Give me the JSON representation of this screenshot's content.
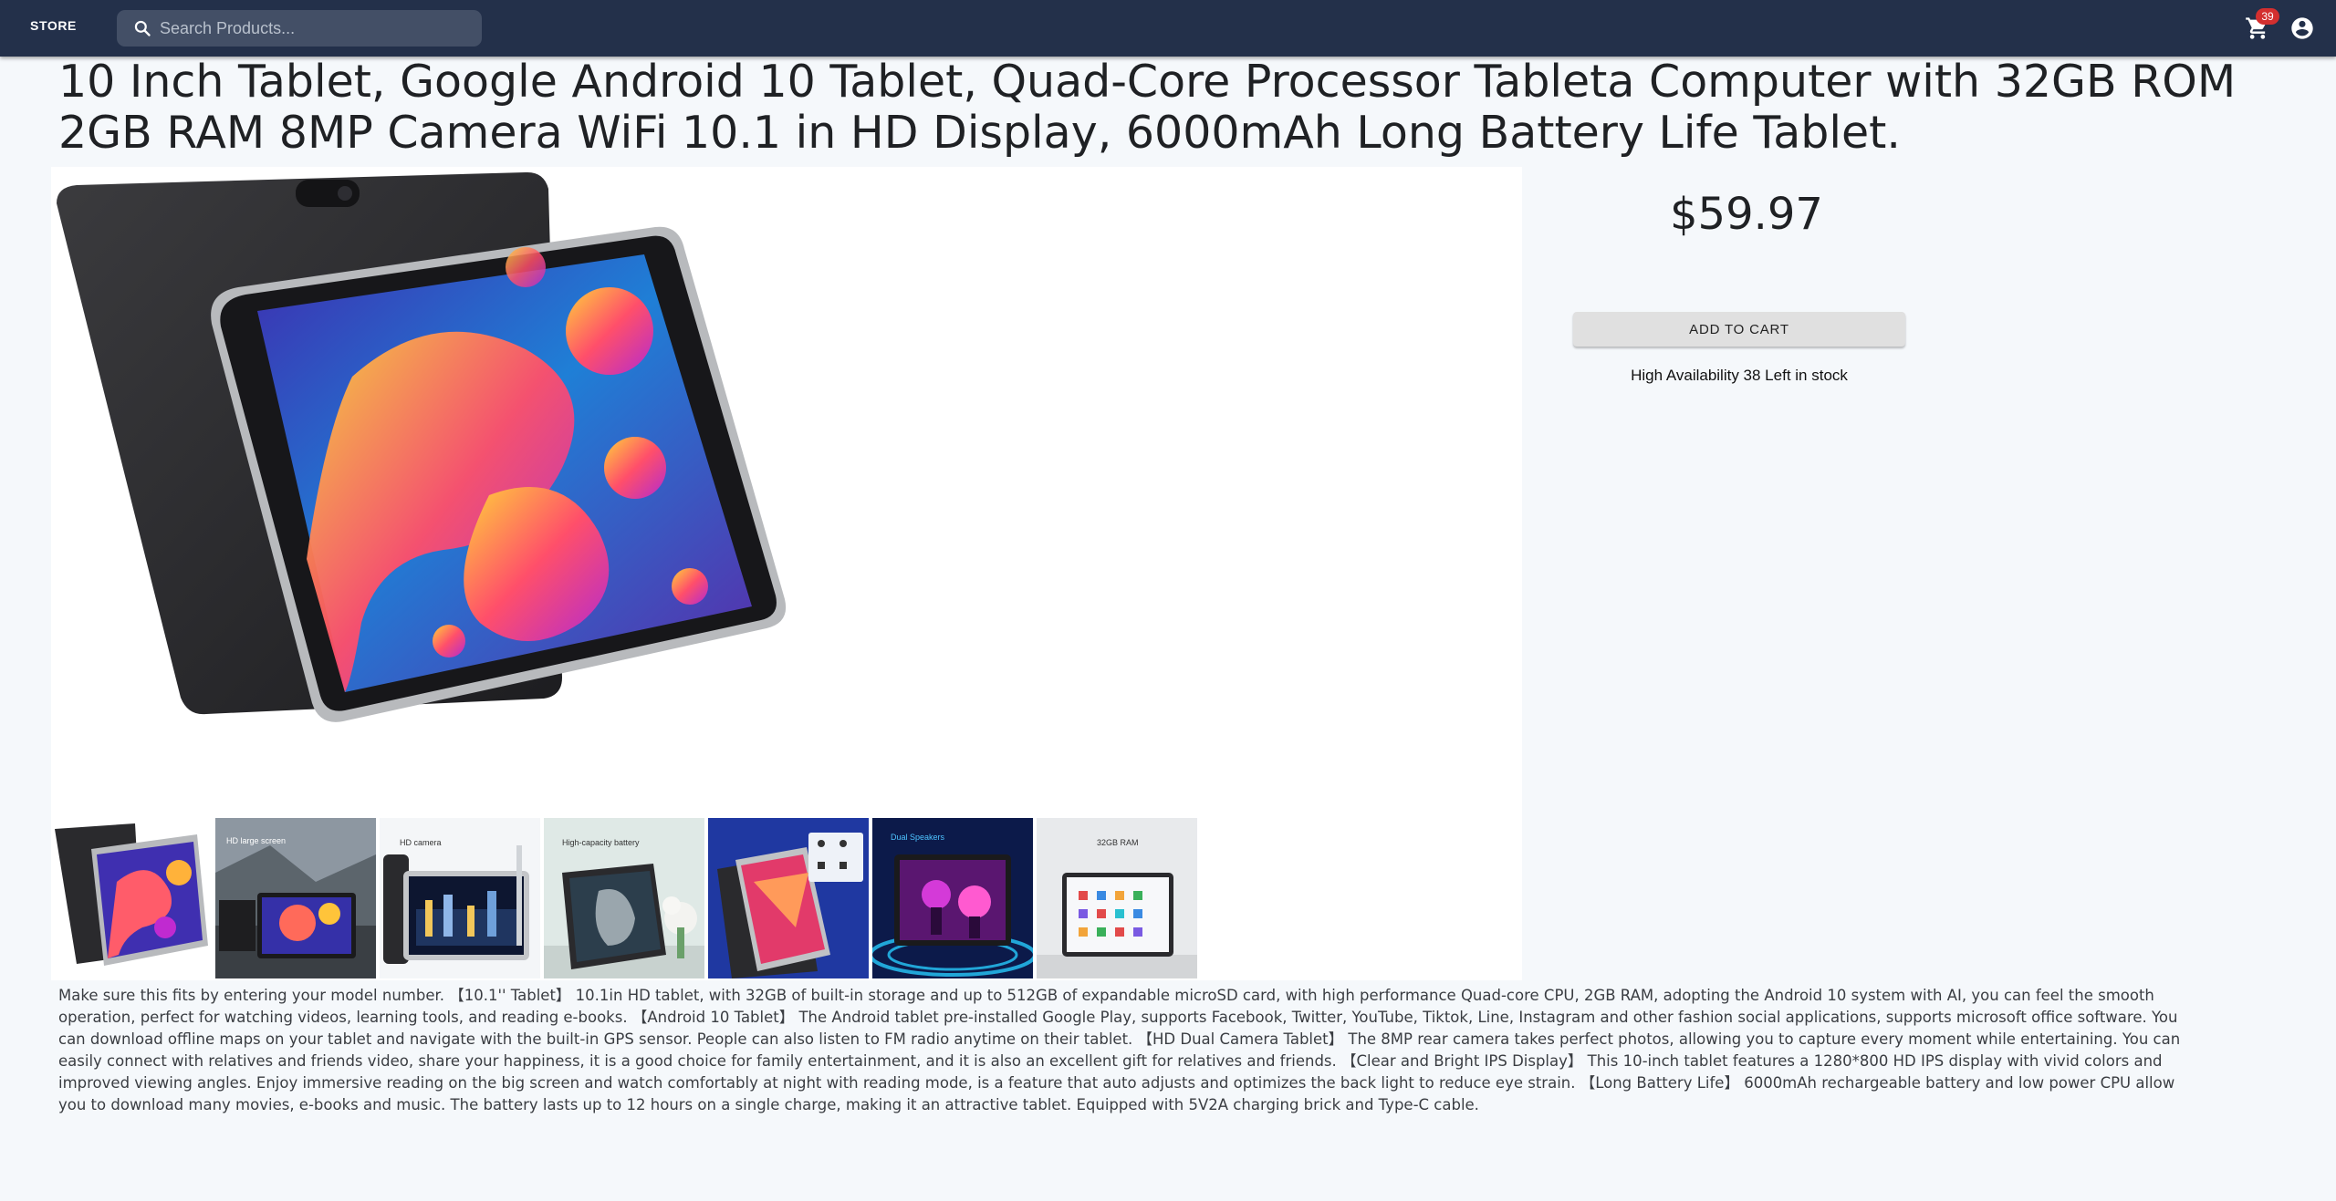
{
  "nav": {
    "brand": "STORE",
    "search_placeholder": "Search Products...",
    "search_value": "",
    "cart_count": "39",
    "icons": {
      "search": "search-icon",
      "cart": "cart-icon",
      "account": "account-circle-icon"
    },
    "colors": {
      "bar": "#23304a",
      "search_bg": "#434f66",
      "badge": "#d32f2f"
    }
  },
  "product": {
    "title": "10 Inch Tablet, Google Android 10 Tablet, Quad-Core Processor Tableta Computer with 32GB ROM 2GB RAM 8MP Camera WiFi 10.1 in HD Display, 6000mAh Long Battery Life Tablet.",
    "price": "$59.97",
    "add_to_cart_label": "ADD TO CART",
    "stock_text": "High Availability 38 Left in stock",
    "description": "Make sure this fits by entering your model number. 【10.1'' Tablet】 10.1in HD tablet, with 32GB of built-in storage and up to 512GB of expandable microSD card, with high performance Quad-core CPU, 2GB RAM, adopting the Android 10 system with AI, you can feel the smooth operation, perfect for watching videos, learning tools, and reading e-books. 【Android 10 Tablet】 The Android tablet pre-installed Google Play, supports Facebook, Twitter, YouTube, Tiktok, Line, Instagram and other fashion social applications, supports microsoft office software. You can download offline maps on your tablet and navigate with the built-in GPS sensor. People can also listen to FM radio anytime on their tablet. 【HD Dual Camera Tablet】 The 8MP rear camera takes perfect photos, allowing you to capture every moment while entertaining. You can easily connect with relatives and friends video, share your happiness, it is a good choice for family entertainment, and it is also an excellent gift for relatives and friends. 【Clear and Bright IPS Display】 This 10-inch tablet features a 1280*800 HD IPS display with vivid colors and improved viewing angles. Enjoy immersive reading on the big screen and watch comfortably at night with reading mode, is a feature that auto adjusts and optimizes the back light to reduce eye strain. 【Long Battery Life】 6000mAh rechargeable battery and low power CPU allow you to download many movies, e-books and music. The battery lasts up to 12 hours on a single charge, making it an attractive tablet. Equipped with 5V2A charging brick and Type-C cable."
  },
  "thumbnails": [
    {
      "caption": ""
    },
    {
      "caption": "HD large screen"
    },
    {
      "caption": "HD camera"
    },
    {
      "caption": "High-capacity battery"
    },
    {
      "caption": ""
    },
    {
      "caption": "Dual Speakers"
    },
    {
      "caption": "32GB RAM"
    }
  ]
}
